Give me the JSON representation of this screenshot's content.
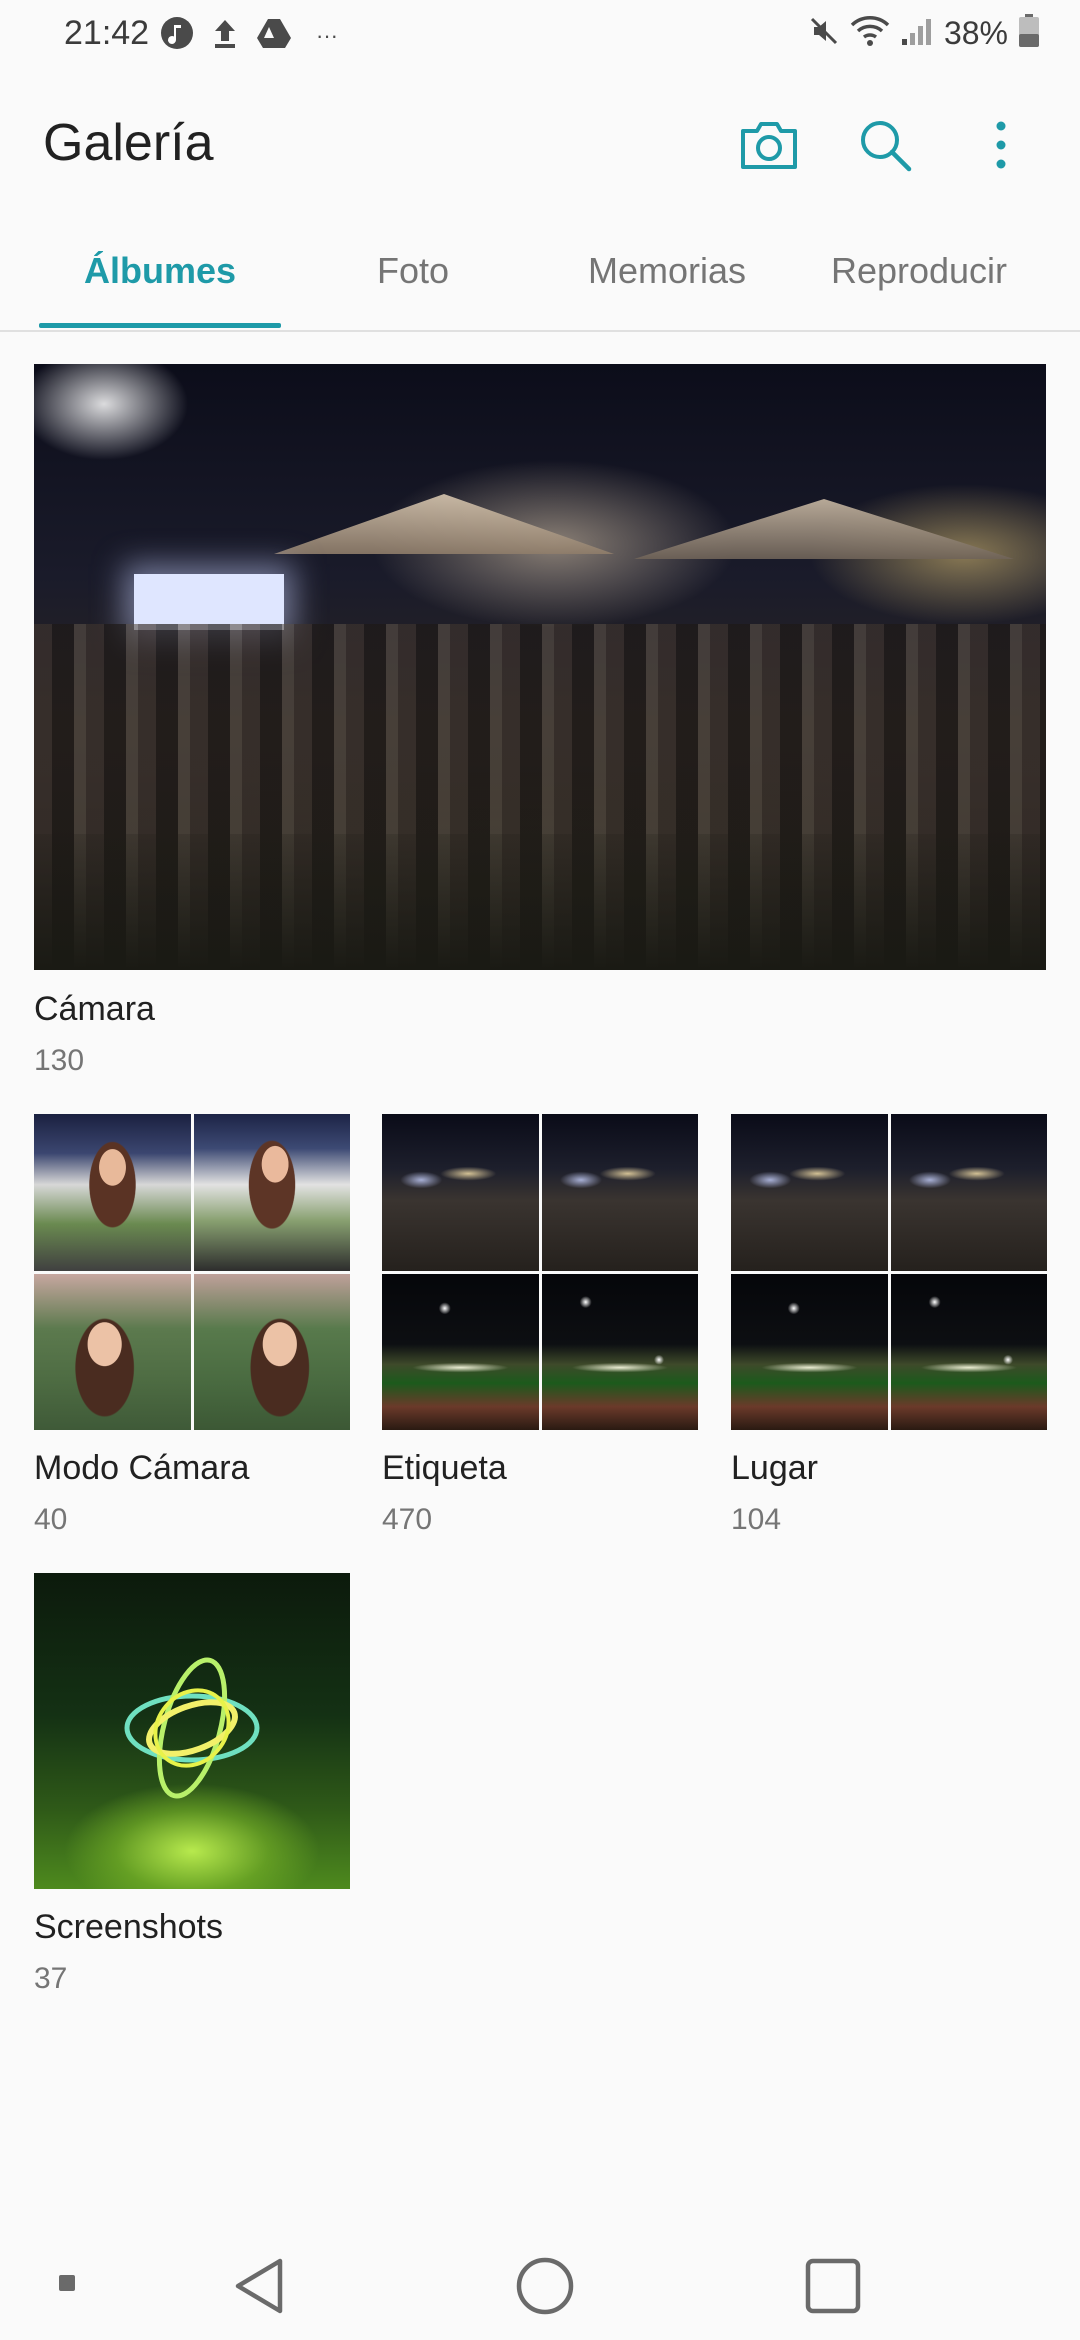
{
  "status_bar": {
    "time": "21:42",
    "battery_percent": "38%",
    "left_icons": [
      "music-icon",
      "upload-icon",
      "drive-icon",
      "more-dots-icon"
    ],
    "right_icons": [
      "mute-icon",
      "wifi-icon",
      "signal-icon",
      "battery-icon"
    ]
  },
  "app_bar": {
    "title": "Galería",
    "actions": [
      "camera-icon",
      "search-icon",
      "overflow-menu-icon"
    ]
  },
  "tabs": [
    {
      "label": "Álbumes",
      "active": true
    },
    {
      "label": "Foto",
      "active": false
    },
    {
      "label": "Memorias",
      "active": false
    },
    {
      "label": "Reproducir",
      "active": false
    }
  ],
  "albums": {
    "featured": {
      "name": "Cámara",
      "count": "130"
    },
    "grid": [
      {
        "name": "Modo Cámara",
        "count": "40"
      },
      {
        "name": "Etiqueta",
        "count": "470"
      },
      {
        "name": "Lugar",
        "count": "104"
      },
      {
        "name": "Screenshots",
        "count": "37"
      }
    ]
  },
  "nav_bar": [
    "dot-icon",
    "back-icon",
    "home-icon",
    "recents-icon"
  ],
  "colors": {
    "accent": "#1e9aa8",
    "background": "#fafafa",
    "text_secondary": "#757575"
  }
}
